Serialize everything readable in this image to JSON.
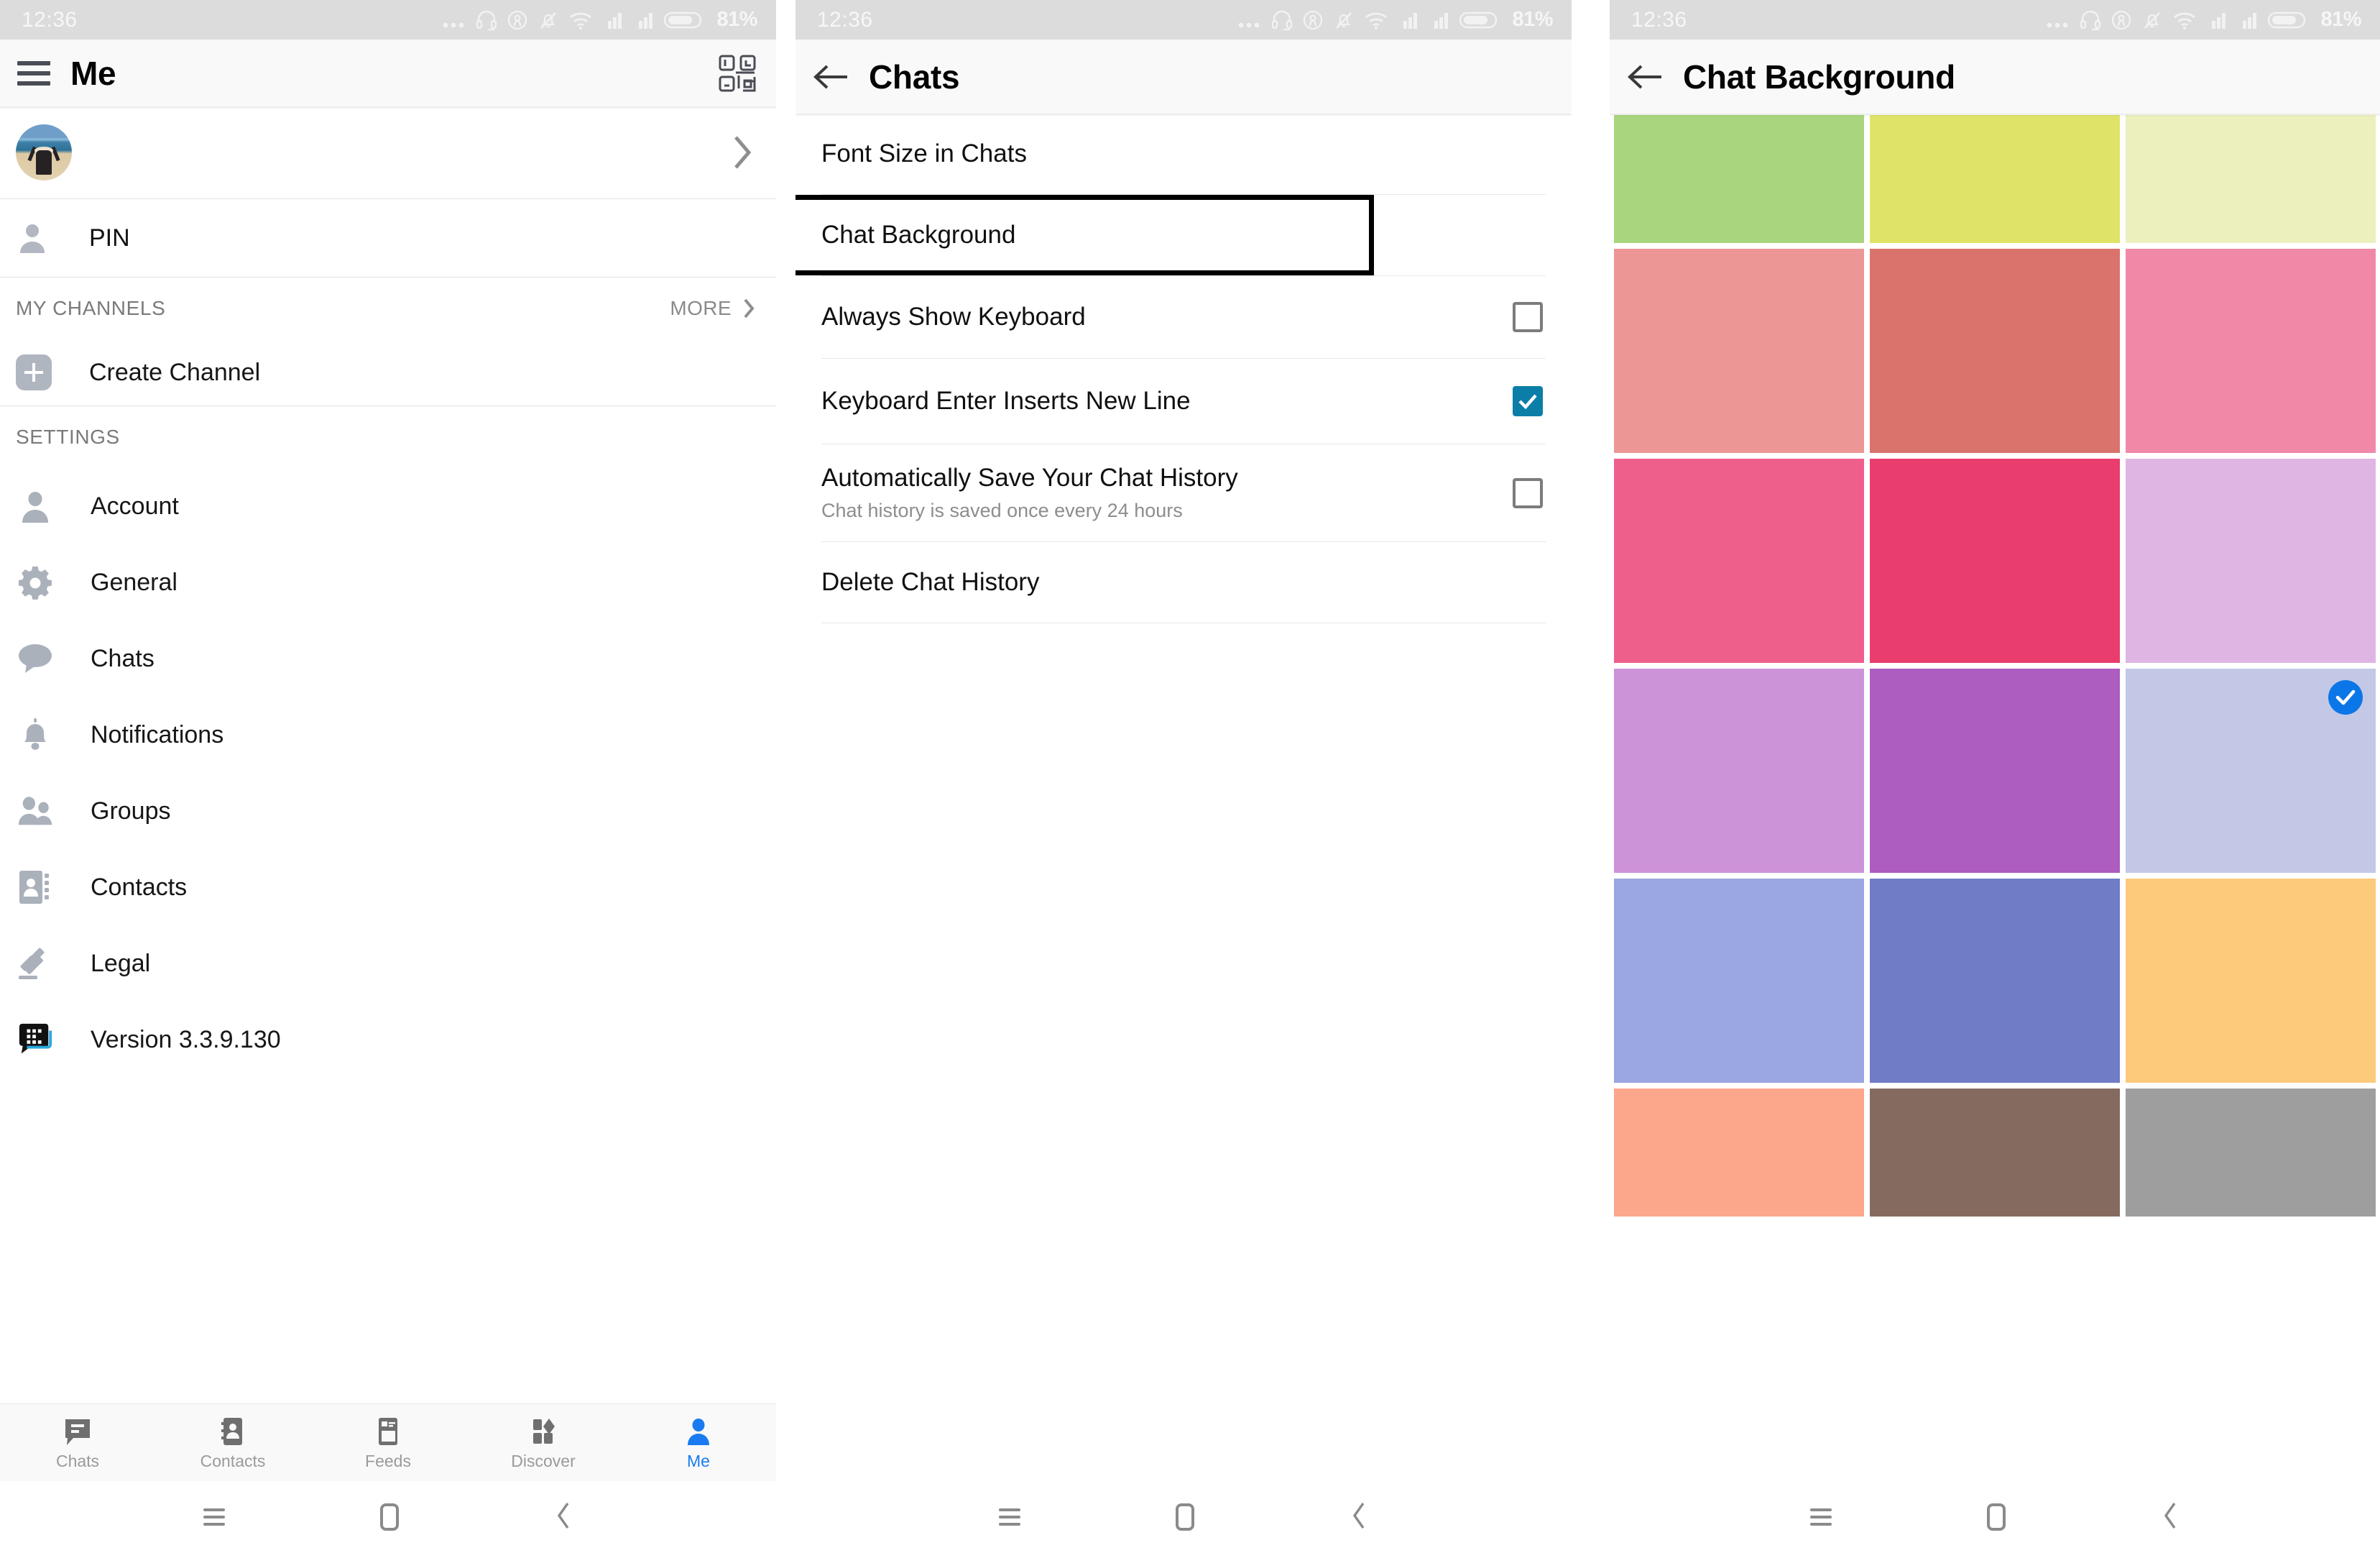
{
  "status_bar": {
    "time": "12:36",
    "battery_percent": "81%",
    "icons": [
      "more-dots-icon",
      "headset-icon",
      "location-icon",
      "bell-muted-icon",
      "wifi-icon",
      "signal-1-icon",
      "signal-2-icon",
      "battery-icon"
    ]
  },
  "panel_me": {
    "appbar": {
      "title": "Me",
      "menu_icon": "hamburger-icon",
      "right_icon": "qr-scan-icon"
    },
    "profile": {
      "name": "",
      "chevron": "chevron-right-icon",
      "avatar": "user-avatar"
    },
    "pin": {
      "label": "PIN",
      "icon": "person-icon"
    },
    "my_channels": {
      "title": "MY CHANNELS",
      "more_label": "MORE"
    },
    "create_channel": {
      "label": "Create Channel",
      "icon": "plus-icon"
    },
    "settings_title": "SETTINGS",
    "settings_items": [
      {
        "label": "Account",
        "icon": "person-filled-icon"
      },
      {
        "label": "General",
        "icon": "gear-icon"
      },
      {
        "label": "Chats",
        "icon": "chat-bubble-icon"
      },
      {
        "label": "Notifications",
        "icon": "bell-icon"
      },
      {
        "label": "Groups",
        "icon": "people-icon"
      },
      {
        "label": "Contacts",
        "icon": "contact-card-icon"
      },
      {
        "label": "Legal",
        "icon": "gavel-icon"
      },
      {
        "label": "Version 3.3.9.130",
        "icon": "bbm-app-icon"
      }
    ],
    "tabs": [
      {
        "label": "Chats",
        "icon": "chat-icon",
        "active": false
      },
      {
        "label": "Contacts",
        "icon": "contacts-icon",
        "active": false
      },
      {
        "label": "Feeds",
        "icon": "feeds-icon",
        "active": false
      },
      {
        "label": "Discover",
        "icon": "discover-icon",
        "active": false
      },
      {
        "label": "Me",
        "icon": "person-icon",
        "active": true
      }
    ]
  },
  "panel_chats": {
    "appbar": {
      "title": "Chats",
      "back_icon": "back-arrow-icon"
    },
    "rows": [
      {
        "title": "Font Size in Chats",
        "sub": "",
        "control": "none",
        "highlighted": false
      },
      {
        "title": "Chat Background",
        "sub": "",
        "control": "none",
        "highlighted": true
      },
      {
        "title": "Always Show Keyboard",
        "sub": "",
        "control": "checkbox",
        "checked": false,
        "highlighted": false
      },
      {
        "title": "Keyboard Enter Inserts New Line",
        "sub": "",
        "control": "checkbox",
        "checked": true,
        "highlighted": false
      },
      {
        "title": "Automatically Save Your Chat History",
        "sub": "Chat history is saved once every 24 hours",
        "control": "checkbox",
        "checked": false,
        "highlighted": false
      },
      {
        "title": "Delete Chat History",
        "sub": "",
        "control": "none",
        "highlighted": false
      }
    ]
  },
  "panel_background": {
    "appbar": {
      "title": "Chat Background",
      "back_icon": "back-arrow-icon"
    },
    "selected_index": 11,
    "selected_check_color": "#0b76e8",
    "swatches": [
      {
        "color": "#a9d57e",
        "name": "green"
      },
      {
        "color": "#dfe468",
        "name": "yellow-green"
      },
      {
        "color": "#ecf0bd",
        "name": "pale-yellow"
      },
      {
        "color": "#ec9796",
        "name": "salmon-pink"
      },
      {
        "color": "#d9736c",
        "name": "terracotta"
      },
      {
        "color": "#f089a8",
        "name": "rose-pink"
      },
      {
        "color": "#ef5f8c",
        "name": "hot-pink"
      },
      {
        "color": "#e93d6e",
        "name": "crimson-pink"
      },
      {
        "color": "#dfb5e3",
        "name": "light-orchid"
      },
      {
        "color": "#cd93d9",
        "name": "orchid"
      },
      {
        "color": "#ad5cbf",
        "name": "purple"
      },
      {
        "color": "#c3c8e6",
        "name": "periwinkle-light"
      },
      {
        "color": "#9aa7e0",
        "name": "periwinkle"
      },
      {
        "color": "#707cc5",
        "name": "indigo"
      },
      {
        "color": "#fcca7b",
        "name": "amber"
      },
      {
        "color": "#fca68b",
        "name": "peach"
      },
      {
        "color": "#856a60",
        "name": "brown"
      },
      {
        "color": "#9e9e9e",
        "name": "grey"
      }
    ]
  },
  "nav_bar": {
    "recent_icon": "recents-icon",
    "home_icon": "home-icon",
    "back_icon": "back-icon"
  },
  "colors": {
    "accent": "#1a7bf0",
    "checkbox_checked": "#0b7ea8",
    "statusbar_bg": "#dcdcdc",
    "appbar_bg": "#f9f9f9"
  }
}
